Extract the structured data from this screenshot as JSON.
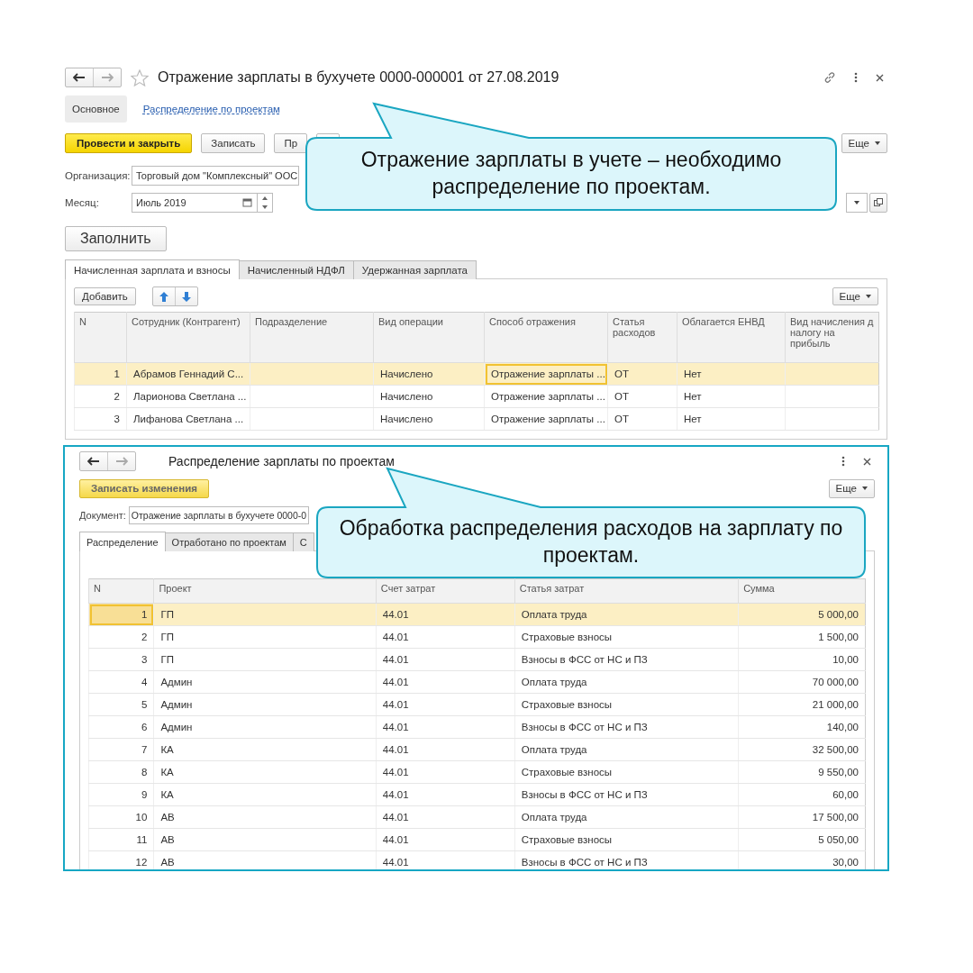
{
  "main_window": {
    "title": "Отражение зарплаты в бухучете 0000-000001 от 27.08.2019",
    "sections": [
      {
        "label": "Основное",
        "selected": true
      },
      {
        "label": "Распределение по проектам",
        "selected": false
      }
    ],
    "toolbar": [
      {
        "kind": "primary",
        "label": "Провести и закрыть"
      },
      {
        "kind": "normal",
        "label": "Записать"
      },
      {
        "kind": "normal",
        "label": "Пр"
      },
      {
        "kind": "icon"
      }
    ],
    "more_button": "Еще",
    "organization": {
      "label": "Организация:",
      "value": "Торговый дом \"Комплексный\" ООС"
    },
    "month": {
      "label": "Месяц:",
      "value": "Июль 2019"
    },
    "fill_button": "Заполнить",
    "tabs": [
      {
        "label": "Начисленная зарплата и взносы",
        "selected": true
      },
      {
        "label": "Начисленный НДФЛ",
        "selected": false
      },
      {
        "label": "Удержанная зарплата",
        "selected": false
      }
    ],
    "table_toolbar": {
      "add_button": "Добавить",
      "more_button": "Еще"
    },
    "table": {
      "columns": [
        {
          "label": "N",
          "kind": "number"
        },
        {
          "label": "Сотрудник (Контрагент)",
          "kind": "text"
        },
        {
          "label": "Подразделение",
          "kind": "text"
        },
        {
          "label": "Вид операции",
          "kind": "text"
        },
        {
          "label": "Способ отражения",
          "kind": "text"
        },
        {
          "label": "Статья расходов",
          "kind": "text"
        },
        {
          "label": "Облагается ЕНВД",
          "kind": "text"
        },
        {
          "label": "Вид начисления д налогу на прибыль",
          "kind": "text"
        }
      ],
      "rows": [
        {
          "cells": [
            "1",
            "Абрамов Геннадий С...",
            null,
            "Начислено",
            {
              "text": "Отражение зарплаты ...",
              "focused": true
            },
            "ОТ",
            "Нет",
            null
          ],
          "selected": true
        },
        {
          "cells": [
            "2",
            "Ларионова Светлана ...",
            null,
            "Начислено",
            "Отражение зарплаты ...",
            "ОТ",
            "Нет",
            null
          ],
          "selected": false
        },
        {
          "cells": [
            "3",
            "Лифанова Светлана ...",
            null,
            "Начислено",
            "Отражение зарплаты ...",
            "ОТ",
            "Нет",
            null
          ],
          "selected": false
        }
      ]
    }
  },
  "distribution_window": {
    "title": "Распределение зарплаты по проектам",
    "save_button": "Записать изменения",
    "more_button": "Еще",
    "document": {
      "label": "Документ:",
      "value": "Отражение зарплаты в бухучете 0000-0"
    },
    "tabs": [
      {
        "label": "Распределение",
        "selected": true
      },
      {
        "label": "Отработано по проектам",
        "selected": false
      },
      {
        "label": "С",
        "selected": false
      }
    ],
    "table": {
      "columns": [
        {
          "label": "N",
          "kind": "number"
        },
        {
          "label": "Проект",
          "kind": "text"
        },
        {
          "label": "Счет затрат",
          "kind": "text"
        },
        {
          "label": "Статья затрат",
          "kind": "text"
        },
        {
          "label": "Сумма",
          "kind": "amount"
        }
      ],
      "rows": [
        {
          "cells": [
            {
              "text": "1",
              "focused": true
            },
            "ГП",
            "44.01",
            "Оплата труда",
            "5 000,00"
          ],
          "selected": true
        },
        {
          "cells": [
            "2",
            "ГП",
            "44.01",
            "Страховые взносы",
            "1 500,00"
          ],
          "selected": false
        },
        {
          "cells": [
            "3",
            "ГП",
            "44.01",
            "Взносы в ФСС от НС и ПЗ",
            "10,00"
          ],
          "selected": false
        },
        {
          "cells": [
            "4",
            "Админ",
            "44.01",
            "Оплата труда",
            "70 000,00"
          ],
          "selected": false
        },
        {
          "cells": [
            "5",
            "Админ",
            "44.01",
            "Страховые взносы",
            "21 000,00"
          ],
          "selected": false
        },
        {
          "cells": [
            "6",
            "Админ",
            "44.01",
            "Взносы в ФСС от НС и ПЗ",
            "140,00"
          ],
          "selected": false
        },
        {
          "cells": [
            "7",
            "КА",
            "44.01",
            "Оплата труда",
            "32 500,00"
          ],
          "selected": false
        },
        {
          "cells": [
            "8",
            "КА",
            "44.01",
            "Страховые взносы",
            "9 550,00"
          ],
          "selected": false
        },
        {
          "cells": [
            "9",
            "КА",
            "44.01",
            "Взносы в ФСС от НС и ПЗ",
            "60,00"
          ],
          "selected": false
        },
        {
          "cells": [
            "10",
            "АВ",
            "44.01",
            "Оплата труда",
            "17 500,00"
          ],
          "selected": false
        },
        {
          "cells": [
            "11",
            "АВ",
            "44.01",
            "Страховые взносы",
            "5 050,00"
          ],
          "selected": false
        },
        {
          "cells": [
            "12",
            "АВ",
            "44.01",
            "Взносы в ФСС от НС и ПЗ",
            "30,00"
          ],
          "selected": false
        }
      ]
    }
  },
  "callouts": [
    {
      "text": "Отражение зарплаты в учете – необходимо распределение по проектам."
    },
    {
      "text": "Обработка распределения расходов на зарплату по проектам."
    }
  ]
}
